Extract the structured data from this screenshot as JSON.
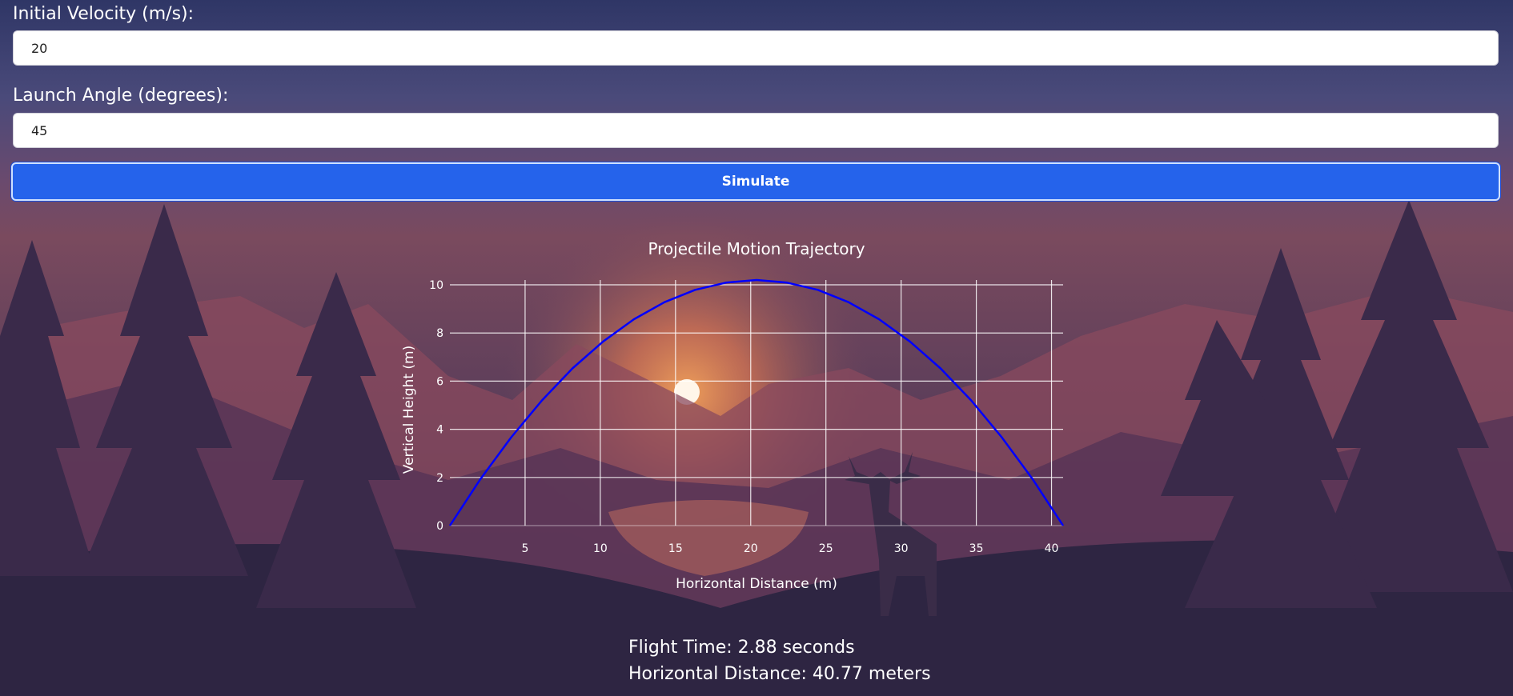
{
  "form": {
    "velocity_label": "Initial Velocity (m/s):",
    "velocity_value": "20",
    "angle_label": "Launch Angle (degrees):",
    "angle_value": "45",
    "simulate_label": "Simulate"
  },
  "results": {
    "flight_time": "Flight Time: 2.88 seconds",
    "horizontal_distance": "Horizontal Distance: 40.77 meters"
  },
  "colors": {
    "button": "#2563eb",
    "trajectory": "#0000ff",
    "grid": "#ffffff"
  },
  "chart_data": {
    "type": "line",
    "title": "Projectile Motion Trajectory",
    "xlabel": "Horizontal Distance (m)",
    "ylabel": "Vertical Height (m)",
    "xlim": [
      0,
      40.77
    ],
    "ylim": [
      0,
      10.2
    ],
    "x_ticks": [
      5,
      10,
      15,
      20,
      25,
      30,
      35,
      40
    ],
    "y_ticks": [
      0,
      2,
      4,
      6,
      8,
      10
    ],
    "grid": true,
    "series": [
      {
        "x": [
          0,
          2.04,
          4.08,
          6.12,
          8.15,
          10.19,
          12.23,
          14.27,
          16.31,
          18.35,
          20.39,
          22.42,
          24.46,
          26.5,
          28.54,
          30.58,
          32.62,
          34.66,
          36.69,
          38.73,
          40.77
        ],
        "y": [
          0,
          1.94,
          3.67,
          5.2,
          6.53,
          7.65,
          8.57,
          9.28,
          9.79,
          10.09,
          10.2,
          10.09,
          9.79,
          9.28,
          8.57,
          7.65,
          6.53,
          5.2,
          3.67,
          1.94,
          0
        ]
      }
    ]
  }
}
